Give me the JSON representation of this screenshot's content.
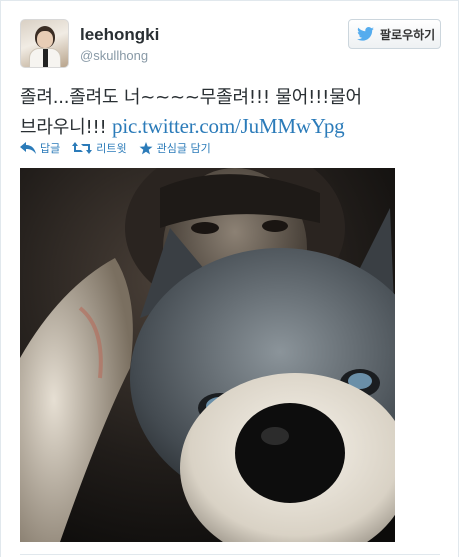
{
  "user": {
    "name": "leehongki",
    "handle": "@skullhong"
  },
  "follow_button": {
    "label": "팔로우하기"
  },
  "tweet": {
    "text_line1": "졸려...졸려도 너~~~~무졸려!!! 물어!!!물어",
    "text_line2_prefix": "브라우니!!! ",
    "link": "pic.twitter.com/JuMMwYpg"
  },
  "actions": {
    "reply": "답글",
    "retweet": "리트윗",
    "favorite": "관심글 담기"
  },
  "colors": {
    "link": "#2b7bb9",
    "name": "#292f33",
    "handle": "#8899a6",
    "twitter_bird": "#55acee"
  },
  "icons": {
    "reply": "reply-arrow-icon",
    "retweet": "retweet-icon",
    "favorite": "star-icon",
    "follow": "twitter-bird-icon"
  }
}
